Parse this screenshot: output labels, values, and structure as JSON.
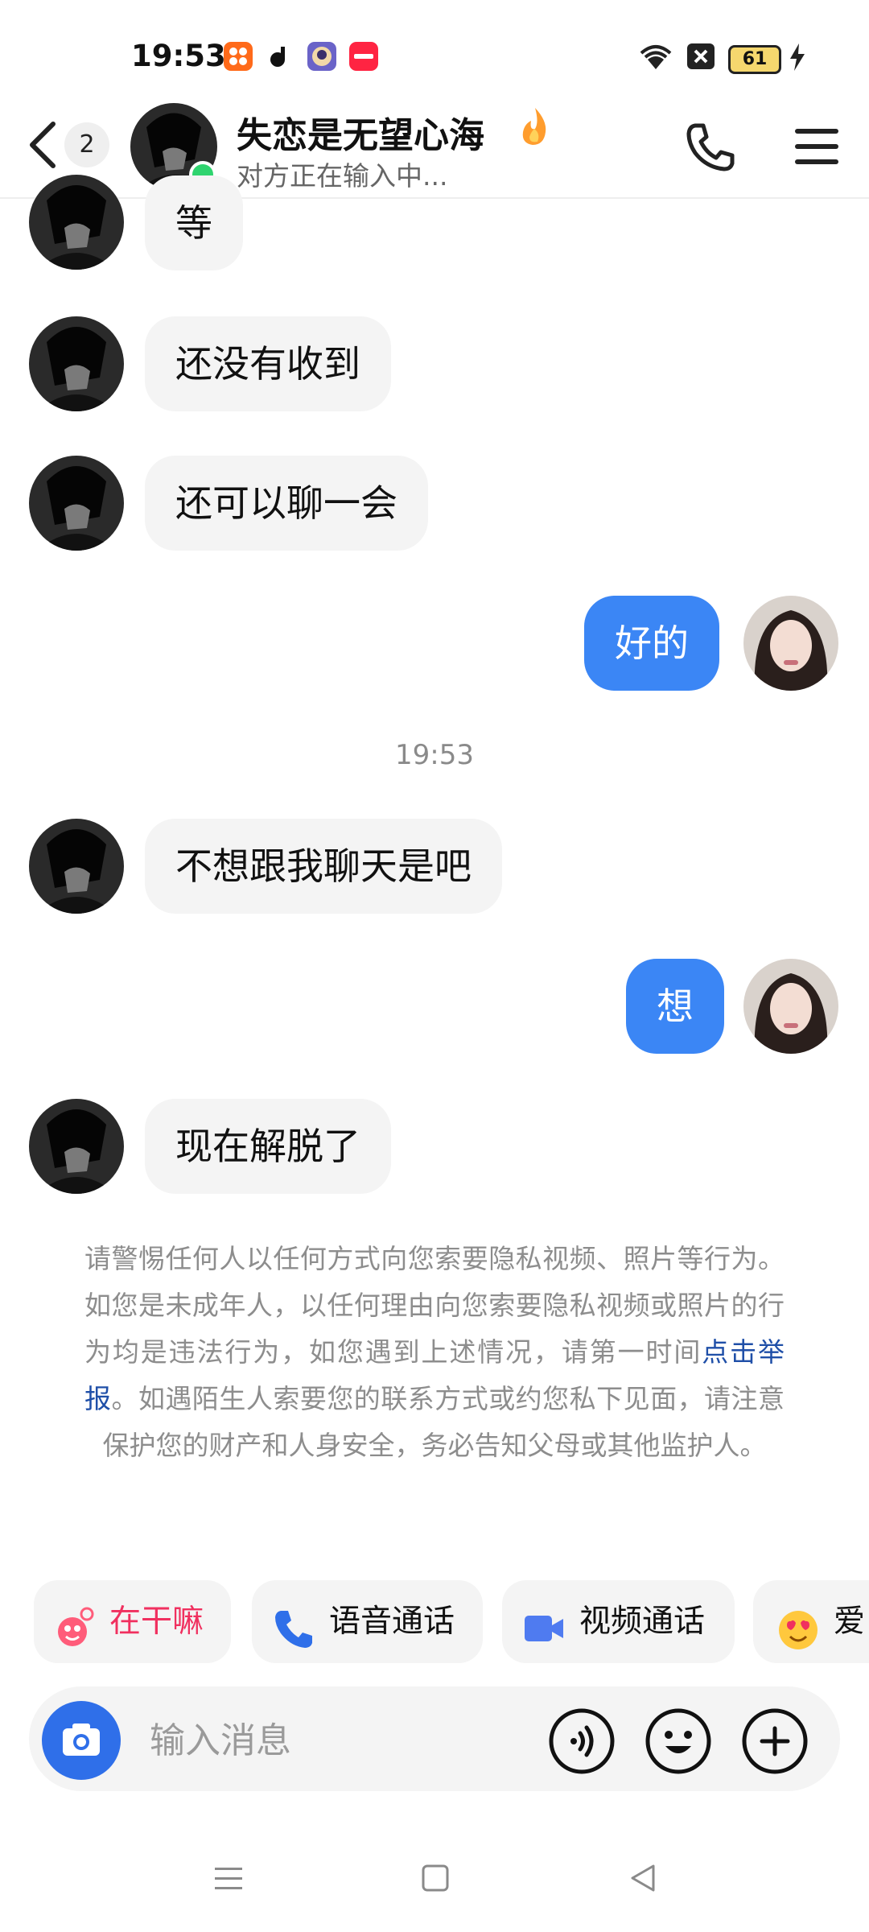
{
  "status_bar": {
    "time": "19:53",
    "battery_level": "61",
    "icons": [
      "taobao-app-icon",
      "tiktok-app-icon",
      "game-app-icon",
      "xiaohongshu-app-icon",
      "wifi-icon",
      "no-sim-icon",
      "battery-icon",
      "charging-icon"
    ]
  },
  "header": {
    "back_icon": "chevron-left-icon",
    "unread_count": "2",
    "contact_name": "失恋是无望心海",
    "status": "对方正在输入中...",
    "call_icon": "phone-icon",
    "menu_icon": "hamburger-menu-icon"
  },
  "messages": [
    {
      "side": "in",
      "text": "等"
    },
    {
      "side": "in",
      "text": "还没有收到"
    },
    {
      "side": "in",
      "text": "还可以聊一会"
    },
    {
      "side": "out",
      "text": "好的"
    },
    {
      "side": "in",
      "text": "不想跟我聊天是吧"
    },
    {
      "side": "out",
      "text": "想"
    },
    {
      "side": "in",
      "text": "现在解脱了"
    }
  ],
  "time_divider": "19:53",
  "safety_notice": {
    "before": "请警惕任何人以任何方式向您索要隐私视频、照片等行为。如您是未成年人，以任何理由向您索要隐私视频或照片的行为均是违法行为，如您遇到上述情况，请第一时间",
    "link": "点击举报",
    "after": "。如遇陌生人索要您的联系方式或约您私下见面，请注意保护您的财产和人身安全，务必告知父母或其他监护人。"
  },
  "quick_actions": [
    {
      "label": "在干嘛",
      "icon": "wave-hello-icon",
      "color": "#f0305f"
    },
    {
      "label": "语音通话",
      "icon": "phone-icon",
      "color": "#111111"
    },
    {
      "label": "视频通话",
      "icon": "video-camera-icon",
      "color": "#111111"
    },
    {
      "label": "爱",
      "icon": "heart-eyes-emoji-icon",
      "color": "#111111"
    }
  ],
  "input_bar": {
    "placeholder": "输入消息",
    "camera_icon": "camera-icon",
    "voice_icon": "voice-icon",
    "emoji_icon": "smiley-icon",
    "plus_icon": "plus-icon"
  },
  "nav_bar": [
    "menu-icon",
    "home-square-icon",
    "back-triangle-icon"
  ],
  "colors": {
    "outgoing_bubble": "#3b86f5",
    "incoming_bubble": "#f4f4f4",
    "link": "#1f4fa8",
    "online": "#2fd46f"
  }
}
